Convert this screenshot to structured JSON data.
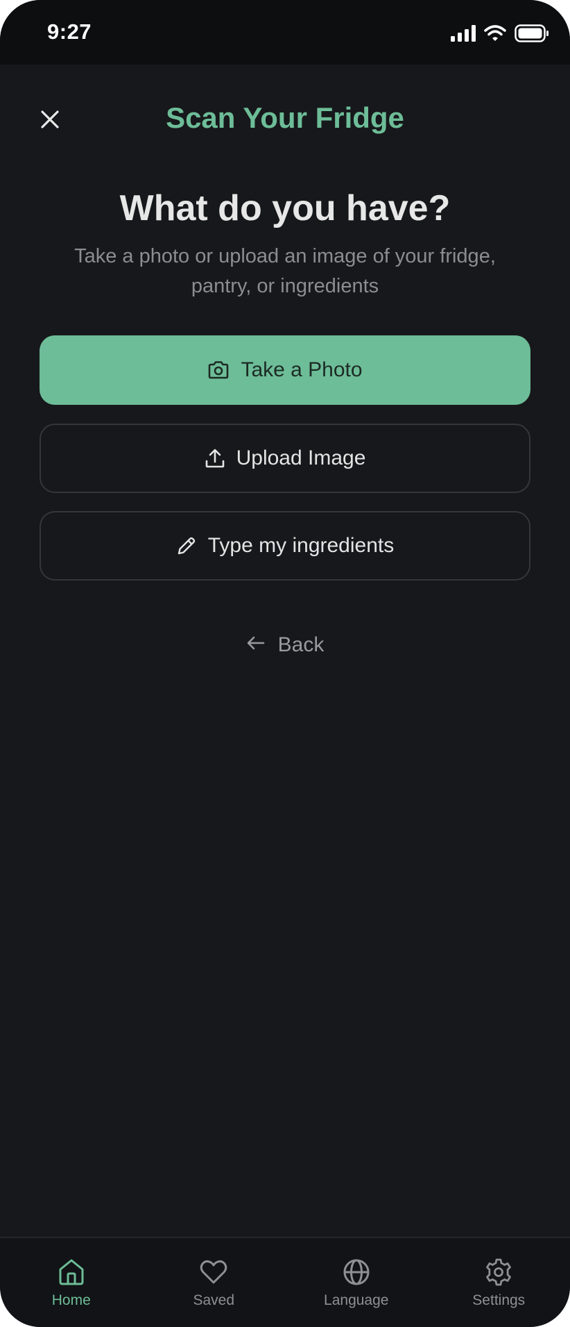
{
  "status_bar": {
    "time": "9:27"
  },
  "header": {
    "title": "Scan Your Fridge",
    "close_icon": "close-icon"
  },
  "hero": {
    "title": "What do you have?",
    "subtitle": "Take a photo or upload an image of your fridge, pantry, or ingredients"
  },
  "actions": {
    "take_photo": {
      "label": "Take a Photo",
      "icon": "camera-icon"
    },
    "upload_image": {
      "label": "Upload Image",
      "icon": "upload-icon"
    },
    "type_ingredients": {
      "label": "Type my ingredients",
      "icon": "pencil-icon"
    }
  },
  "back": {
    "label": "Back",
    "icon": "arrow-left-icon"
  },
  "tabs": [
    {
      "label": "Home",
      "icon": "home-icon",
      "active": true
    },
    {
      "label": "Saved",
      "icon": "heart-icon",
      "active": false
    },
    {
      "label": "Language",
      "icon": "globe-icon",
      "active": false
    },
    {
      "label": "Settings",
      "icon": "gear-icon",
      "active": false
    }
  ],
  "colors": {
    "accent": "#6dbd98",
    "background": "#17181b",
    "status_bar": "#0d0e10",
    "tab_bar": "#121316",
    "text_primary": "#e7e7e7",
    "text_muted": "#8b8d91"
  }
}
